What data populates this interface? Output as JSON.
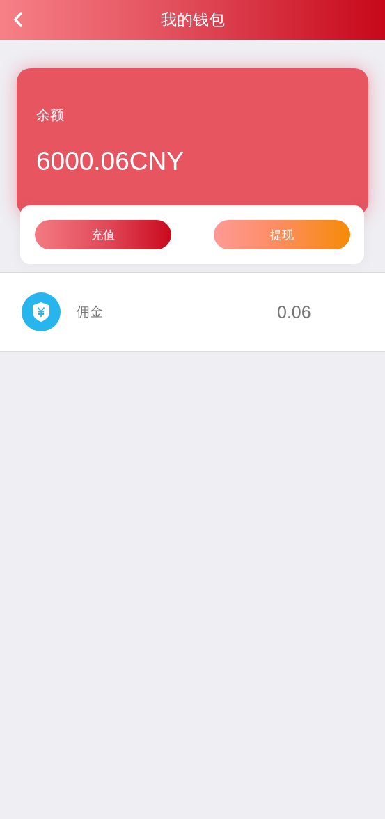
{
  "header": {
    "title": "我的钱包"
  },
  "balance": {
    "label": "余额",
    "amount": "6000.06CNY"
  },
  "actions": [
    {
      "label": "充值",
      "kind": "red"
    },
    {
      "label": "提现",
      "kind": "orange"
    }
  ],
  "items": [
    {
      "name": "佣金",
      "value": "0.06"
    }
  ]
}
